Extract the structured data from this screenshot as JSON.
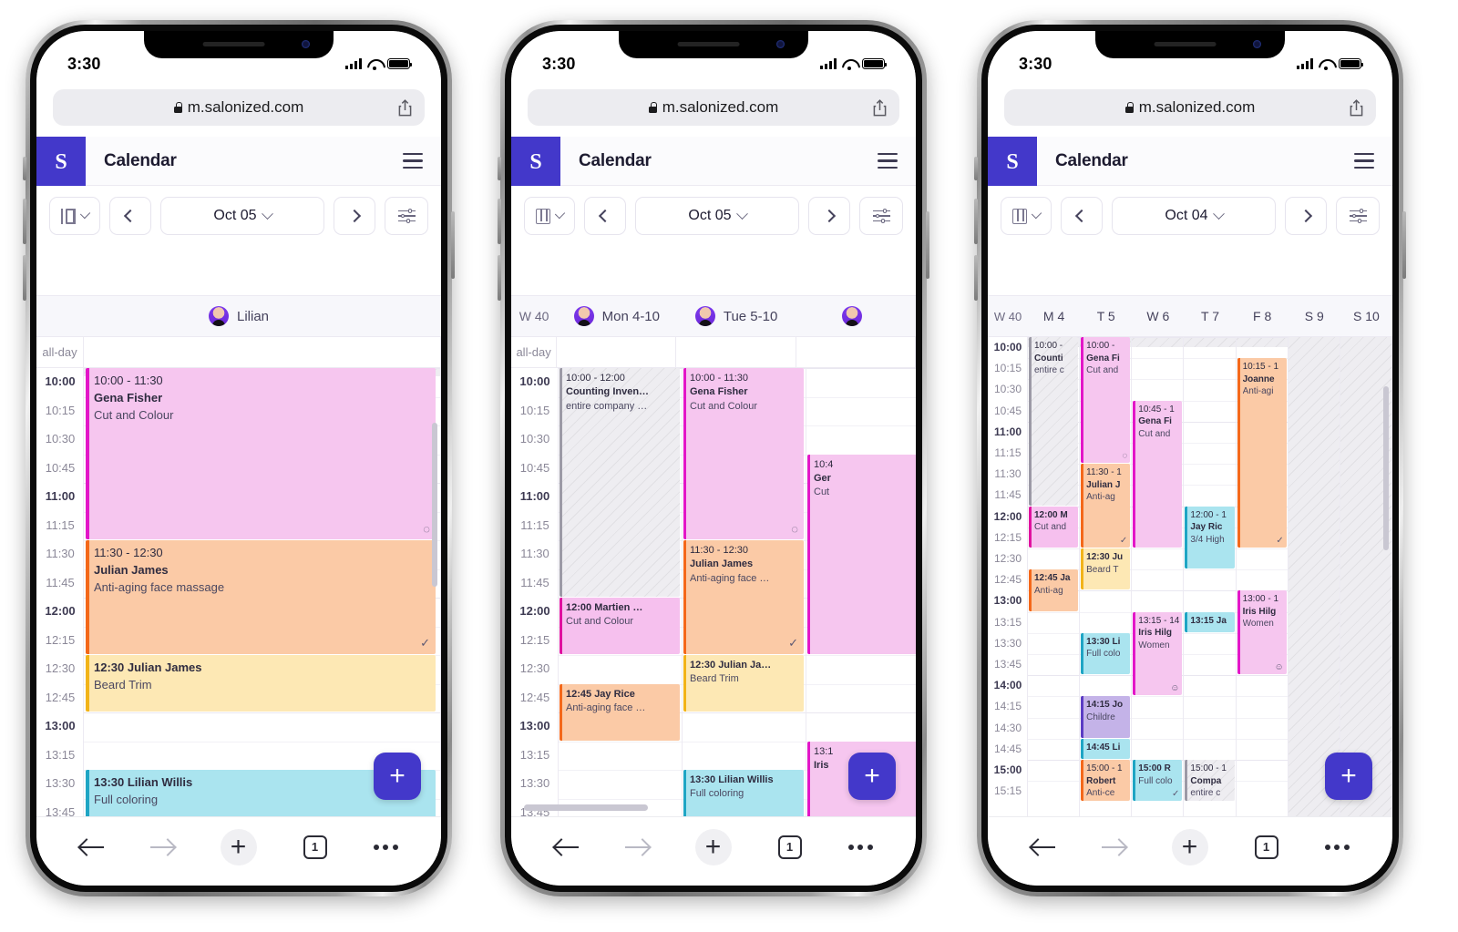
{
  "status_bar": {
    "time": "3:30"
  },
  "browser": {
    "url": "m.salonized.com",
    "tab_count": "1",
    "back_label": "Back",
    "forward_label": "Forward",
    "new_tab_label": "New tab",
    "tabs_label": "Tabs",
    "more_label": "More"
  },
  "app": {
    "logo_letter": "S",
    "title": "Calendar",
    "menu_label": "Menu",
    "brand_color": "#4338ca"
  },
  "phones": [
    {
      "id": "phone-day-view",
      "toolbar": {
        "view_icon": "day-view-icon",
        "view_label": "Day",
        "prev_label": "Previous",
        "date": "Oct 05",
        "next_label": "Next",
        "filter_icon": "filter-sliders-icon"
      },
      "columns": [
        {
          "label": "Lilian",
          "avatar": true
        }
      ],
      "all_day_label": "all-day",
      "time_labels": [
        "10:00",
        "10:15",
        "10:30",
        "10:45",
        "11:00",
        "11:15",
        "11:30",
        "11:45",
        "12:00",
        "12:15",
        "12:30",
        "12:45",
        "13:00",
        "13:15",
        "13:30",
        "13:45"
      ],
      "events": [
        {
          "time": "10:00 - 11:30",
          "name": "Gena Fisher",
          "service": "Cut and Colour",
          "color": "pink",
          "mark": "comment",
          "col": 0,
          "start": "10:00",
          "end": "11:30"
        },
        {
          "time": "11:30 - 12:30",
          "name": "Julian James",
          "service": "Anti-aging face massage",
          "color": "orange",
          "mark": "check",
          "col": 0,
          "start": "11:30",
          "end": "12:30"
        },
        {
          "time": "12:30",
          "name": "Julian James",
          "service": "Beard Trim",
          "color": "yellow",
          "mark": "",
          "col": 0,
          "start": "12:30",
          "end": "13:00",
          "inline": true
        },
        {
          "time": "13:30",
          "name": "Lilian Willis",
          "service": "Full coloring",
          "color": "cyan",
          "mark": "",
          "col": 0,
          "start": "13:30",
          "end": "14:00",
          "inline": true
        }
      ],
      "fab_label": "+"
    },
    {
      "id": "phone-3day-view",
      "toolbar": {
        "view_icon": "week-view-icon",
        "view_label": "Week",
        "prev_label": "Previous",
        "date": "Oct 05",
        "next_label": "Next",
        "filter_icon": "filter-sliders-icon"
      },
      "week_label": "W 40",
      "columns": [
        {
          "label": "Mon 4-10",
          "avatar": true
        },
        {
          "label": "Tue 5-10",
          "avatar": true
        },
        {
          "label": "",
          "avatar": true
        }
      ],
      "all_day_label": "all-day",
      "time_labels": [
        "10:00",
        "10:15",
        "10:30",
        "10:45",
        "11:00",
        "11:15",
        "11:30",
        "11:45",
        "12:00",
        "12:15",
        "12:30",
        "12:45",
        "13:00",
        "13:15",
        "13:30",
        "13:45"
      ],
      "events": [
        {
          "time": "10:00 - 12:00",
          "name": "Counting Inven…",
          "service": "entire company …",
          "color": "hatched",
          "mark": "",
          "col": 0,
          "start": "10:00",
          "end": "12:00"
        },
        {
          "time": "12:00",
          "name": "Martien …",
          "service": "Cut and Colour",
          "color": "magenta",
          "mark": "",
          "col": 0,
          "start": "12:00",
          "end": "12:30",
          "inline": true
        },
        {
          "time": "12:45",
          "name": "Jay Rice",
          "service": "Anti-aging face …",
          "color": "orange",
          "mark": "",
          "col": 0,
          "start": "12:45",
          "end": "13:15",
          "inline": true
        },
        {
          "time": "10:00 - 11:30",
          "name": "Gena Fisher",
          "service": "Cut and Colour",
          "color": "pink",
          "mark": "comment",
          "col": 1,
          "start": "10:00",
          "end": "11:30"
        },
        {
          "time": "11:30 - 12:30",
          "name": "Julian James",
          "service": "Anti-aging face …",
          "color": "orange",
          "mark": "check",
          "col": 1,
          "start": "11:30",
          "end": "12:30"
        },
        {
          "time": "12:30",
          "name": "Julian Ja…",
          "service": "Beard Trim",
          "color": "yellow",
          "mark": "",
          "col": 1,
          "start": "12:30",
          "end": "13:00",
          "inline": true
        },
        {
          "time": "13:30",
          "name": "Lilian Willis",
          "service": "Full coloring",
          "color": "cyan",
          "mark": "",
          "col": 1,
          "start": "13:30",
          "end": "14:00",
          "inline": true
        },
        {
          "time": "10:4",
          "name": "Ger",
          "service": "Cut",
          "color": "pink",
          "mark": "",
          "col": 2,
          "start": "10:45",
          "end": "12:30"
        },
        {
          "time": "13:1",
          "name": "Iris",
          "service": "",
          "color": "pink",
          "mark": "",
          "col": 2,
          "start": "13:15",
          "end": "14:00"
        }
      ],
      "fab_label": "+"
    },
    {
      "id": "phone-week-view",
      "toolbar": {
        "view_icon": "week-view-icon",
        "view_label": "Week",
        "prev_label": "Previous",
        "date": "Oct 04",
        "next_label": "Next",
        "filter_icon": "filter-sliders-icon"
      },
      "week_label": "W 40",
      "columns": [
        {
          "label": "M 4"
        },
        {
          "label": "T 5"
        },
        {
          "label": "W 6"
        },
        {
          "label": "T 7"
        },
        {
          "label": "F 8"
        },
        {
          "label": "S 9"
        },
        {
          "label": "S 10"
        }
      ],
      "time_labels": [
        "10:00",
        "10:15",
        "10:30",
        "10:45",
        "11:00",
        "11:15",
        "11:30",
        "11:45",
        "12:00",
        "12:15",
        "12:30",
        "12:45",
        "13:00",
        "13:15",
        "13:30",
        "13:45",
        "14:00",
        "14:15",
        "14:30",
        "14:45",
        "15:00",
        "15:15"
      ],
      "events": [
        {
          "time": "10:00 - ",
          "name": "Counti",
          "service": "entire c",
          "color": "hatched",
          "mark": "",
          "col": 0,
          "start": "10:00",
          "end": "12:00"
        },
        {
          "time": "12:00 M",
          "name": "",
          "service": "Cut and",
          "color": "magenta",
          "mark": "",
          "col": 0,
          "start": "12:00",
          "end": "12:30",
          "inline": true
        },
        {
          "time": "12:45 Ja",
          "name": "",
          "service": "Anti-ag",
          "color": "orange",
          "mark": "",
          "col": 0,
          "start": "12:45",
          "end": "13:15",
          "inline": true
        },
        {
          "time": "10:00 - ",
          "name": "Gena Fi",
          "service": "Cut and",
          "color": "pink",
          "mark": "comment",
          "col": 1,
          "start": "10:00",
          "end": "11:30"
        },
        {
          "time": "11:30 - 1",
          "name": "Julian J",
          "service": "Anti-ag",
          "color": "orange",
          "mark": "check",
          "col": 1,
          "start": "11:30",
          "end": "12:30"
        },
        {
          "time": "12:30 Ju",
          "name": "",
          "service": "Beard T",
          "color": "yellow",
          "mark": "",
          "col": 1,
          "start": "12:30",
          "end": "13:00",
          "inline": true
        },
        {
          "time": "13:30 Li",
          "name": "",
          "service": "Full colo",
          "color": "cyan",
          "mark": "",
          "col": 1,
          "start": "13:30",
          "end": "14:00",
          "inline": true
        },
        {
          "time": "14:15 Jo",
          "name": "",
          "service": "Childre",
          "color": "purple",
          "mark": "",
          "col": 1,
          "start": "14:15",
          "end": "14:45",
          "inline": true
        },
        {
          "time": "14:45 Li",
          "name": "",
          "service": "",
          "color": "cyan",
          "mark": "",
          "col": 1,
          "start": "14:45",
          "end": "15:00",
          "inline": true
        },
        {
          "time": "15:00 - 1",
          "name": "Robert",
          "service": "Anti-ce",
          "color": "orange",
          "mark": "",
          "col": 1,
          "start": "15:00",
          "end": "15:30"
        },
        {
          "time": "10:45 - 1",
          "name": "Gena Fi",
          "service": "Cut and",
          "color": "pink",
          "mark": "",
          "col": 2,
          "start": "10:45",
          "end": "12:30"
        },
        {
          "time": "13:15 - 14",
          "name": "Iris Hilg",
          "service": "Women",
          "color": "pink",
          "mark": "smile",
          "col": 2,
          "start": "13:15",
          "end": "14:15"
        },
        {
          "time": "15:00 R",
          "name": "",
          "service": "Full colo",
          "color": "cyan",
          "mark": "check",
          "col": 2,
          "start": "15:00",
          "end": "15:30",
          "inline": true
        },
        {
          "time": "12:00 - 1",
          "name": "Jay Ric",
          "service": "3/4 High",
          "color": "cyan",
          "mark": "",
          "col": 3,
          "start": "12:00",
          "end": "12:45"
        },
        {
          "time": "13:15 Ja",
          "name": "",
          "service": "",
          "color": "cyan",
          "mark": "",
          "col": 3,
          "start": "13:15",
          "end": "13:30",
          "inline": true
        },
        {
          "time": "15:00 - 1",
          "name": "Compa",
          "service": "entire c",
          "color": "hatched",
          "mark": "",
          "col": 3,
          "start": "15:00",
          "end": "15:30"
        },
        {
          "time": "10:15 - 1",
          "name": "Joanne",
          "service": "Anti-agi",
          "color": "orange",
          "mark": "check",
          "col": 4,
          "start": "10:15",
          "end": "12:30"
        },
        {
          "time": "13:00 - 1",
          "name": "Iris Hilg",
          "service": "Women",
          "color": "pink",
          "mark": "smile",
          "col": 4,
          "start": "13:00",
          "end": "14:00"
        }
      ],
      "fab_label": "+"
    }
  ],
  "colors": {
    "pink_bg": "#f6c6ef",
    "pink_bar": "#e316c8",
    "magenta_bg": "#f6c0ee",
    "magenta_bar": "#e0119f",
    "orange_bg": "#fbcaa6",
    "orange_bar": "#f4681a",
    "yellow_bg": "#fde8b4",
    "yellow_bar": "#f2b419",
    "cyan_bg": "#aae4ef",
    "cyan_bar": "#1fa5c4",
    "purple_bg": "#c4b3e8",
    "purple_bar": "#5b3cc4",
    "hatched_bg": "#eeedf1",
    "hatched_bar": "#9c9aa6"
  }
}
